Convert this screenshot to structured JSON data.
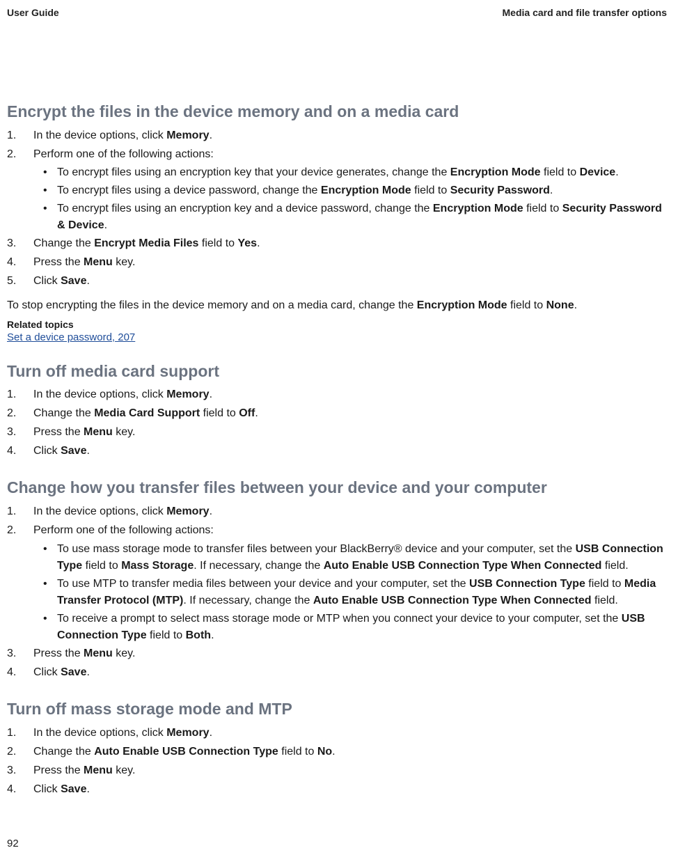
{
  "header": {
    "left": "User Guide",
    "right": "Media card and file transfer options"
  },
  "page_number": "92",
  "related": {
    "label": "Related topics",
    "link": "Set a device password, 207"
  },
  "sections": [
    {
      "title": "Encrypt the files in the device memory and on a media card",
      "steps": [
        {
          "n": "1.",
          "pre": "In the device options, click ",
          "b1": "Memory",
          "post": "."
        },
        {
          "n": "2.",
          "pre": "Perform one of the following actions:",
          "bullets": [
            {
              "pre": "To encrypt files using an encryption key that your device generates, change the ",
              "b1": "Encryption Mode",
              "mid1": " field to ",
              "b2": "Device",
              "post": "."
            },
            {
              "pre": "To encrypt files using a device password, change the ",
              "b1": "Encryption Mode",
              "mid1": " field to ",
              "b2": "Security Password",
              "post": "."
            },
            {
              "pre": "To encrypt files using an encryption key and a device password, change the ",
              "b1": "Encryption Mode",
              "mid1": " field to ",
              "b2": "Security Password & Device",
              "post": "."
            }
          ]
        },
        {
          "n": "3.",
          "pre": "Change the ",
          "b1": "Encrypt Media Files",
          "mid1": " field to ",
          "b2": "Yes",
          "post": "."
        },
        {
          "n": "4.",
          "pre": "Press the ",
          "b1": "Menu",
          "post": " key."
        },
        {
          "n": "5.",
          "pre": "Click ",
          "b1": "Save",
          "post": "."
        }
      ],
      "after_para": {
        "pre": "To stop encrypting the files in the device memory and on a media card, change the ",
        "b1": "Encryption Mode",
        "mid1": " field to ",
        "b2": "None",
        "post": "."
      }
    },
    {
      "title": "Turn off media card support",
      "steps": [
        {
          "n": "1.",
          "pre": "In the device options, click ",
          "b1": "Memory",
          "post": "."
        },
        {
          "n": "2.",
          "pre": "Change the ",
          "b1": "Media Card Support",
          "mid1": " field to ",
          "b2": "Off",
          "post": "."
        },
        {
          "n": "3.",
          "pre": "Press the ",
          "b1": "Menu",
          "post": " key."
        },
        {
          "n": "4.",
          "pre": "Click ",
          "b1": "Save",
          "post": "."
        }
      ]
    },
    {
      "title": "Change how you transfer files between your device and your computer",
      "steps": [
        {
          "n": "1.",
          "pre": "In the device options, click ",
          "b1": "Memory",
          "post": "."
        },
        {
          "n": "2.",
          "pre": "Perform one of the following actions:",
          "bullets": [
            {
              "pre": "To use mass storage mode to transfer files between your BlackBerry® device and your computer, set the ",
              "b1": "USB Connection Type",
              "mid1": " field to ",
              "b2": "Mass Storage",
              "mid2": ". If necessary, change the ",
              "b3": "Auto Enable USB Connection Type When Connected",
              "post": " field."
            },
            {
              "pre": "To use MTP to transfer media files between your device and your computer, set the ",
              "b1": "USB Connection Type",
              "mid1": " field to ",
              "b2": "Media Transfer Protocol (MTP)",
              "mid2": ". If necessary, change the ",
              "b3": "Auto Enable USB Connection Type When Connected",
              "post": " field."
            },
            {
              "pre": "To receive a prompt to select mass storage mode or MTP when you connect your device to your computer, set the ",
              "b1": "USB Connection Type",
              "mid1": " field to ",
              "b2": "Both",
              "post": "."
            }
          ]
        },
        {
          "n": "3.",
          "pre": "Press the ",
          "b1": "Menu",
          "post": " key."
        },
        {
          "n": "4.",
          "pre": "Click ",
          "b1": "Save",
          "post": "."
        }
      ]
    },
    {
      "title": "Turn off mass storage mode and MTP",
      "steps": [
        {
          "n": "1.",
          "pre": "In the device options, click ",
          "b1": "Memory",
          "post": "."
        },
        {
          "n": "2.",
          "pre": "Change the ",
          "b1": "Auto Enable USB Connection Type",
          "mid1": " field to ",
          "b2": "No",
          "post": "."
        },
        {
          "n": "3.",
          "pre": "Press the ",
          "b1": "Menu",
          "post": " key."
        },
        {
          "n": "4.",
          "pre": "Click ",
          "b1": "Save",
          "post": "."
        }
      ]
    }
  ]
}
